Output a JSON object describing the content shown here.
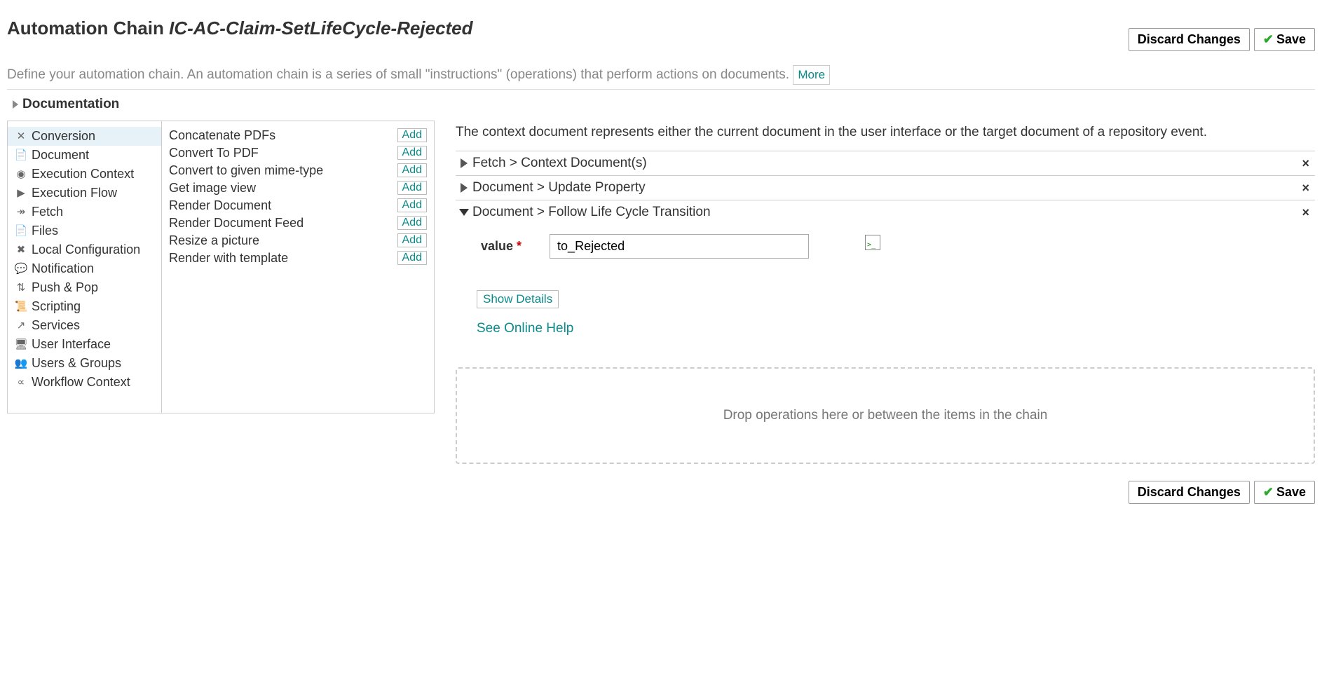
{
  "header": {
    "title_prefix": "Automation Chain ",
    "chain_name": "IC-AC-Claim-SetLifeCycle-Rejected",
    "discard_label": "Discard Changes",
    "save_label": "Save"
  },
  "description": {
    "text": "Define your automation chain. An automation chain is a series of small \"instructions\" (operations) that perform actions on documents.",
    "more_label": "More"
  },
  "documentation_label": "Documentation",
  "categories": [
    {
      "label": "Conversion",
      "icon": "✕",
      "selected": true
    },
    {
      "label": "Document",
      "icon": "📄"
    },
    {
      "label": "Execution Context",
      "icon": "◉"
    },
    {
      "label": "Execution Flow",
      "icon": "▶"
    },
    {
      "label": "Fetch",
      "icon": "↠"
    },
    {
      "label": "Files",
      "icon": "📄"
    },
    {
      "label": "Local Configuration",
      "icon": "✖"
    },
    {
      "label": "Notification",
      "icon": "💬"
    },
    {
      "label": "Push & Pop",
      "icon": "⇅"
    },
    {
      "label": "Scripting",
      "icon": "📜"
    },
    {
      "label": "Services",
      "icon": "↗"
    },
    {
      "label": "User Interface",
      "icon": "🖥"
    },
    {
      "label": "Users & Groups",
      "icon": "👥"
    },
    {
      "label": "Workflow Context",
      "icon": "∝"
    }
  ],
  "operations": [
    {
      "label": "Concatenate PDFs"
    },
    {
      "label": "Convert To PDF"
    },
    {
      "label": "Convert to given mime-type"
    },
    {
      "label": "Get image view"
    },
    {
      "label": "Render Document"
    },
    {
      "label": "Render Document Feed"
    },
    {
      "label": "Resize a picture"
    },
    {
      "label": "Render with template"
    }
  ],
  "add_label": "Add",
  "right": {
    "context_text": "The context document represents either the current document in the user interface or the target document of a repository event.",
    "chain": [
      {
        "title": "Fetch > Context Document(s)",
        "expanded": false
      },
      {
        "title": "Document > Update Property",
        "expanded": false
      },
      {
        "title": "Document > Follow Life Cycle Transition",
        "expanded": true
      }
    ],
    "param_label": "value",
    "param_value": "to_Rejected",
    "show_details": "Show Details",
    "help_link": "See Online Help",
    "dropzone_text": "Drop operations here or between the items in the chain"
  }
}
